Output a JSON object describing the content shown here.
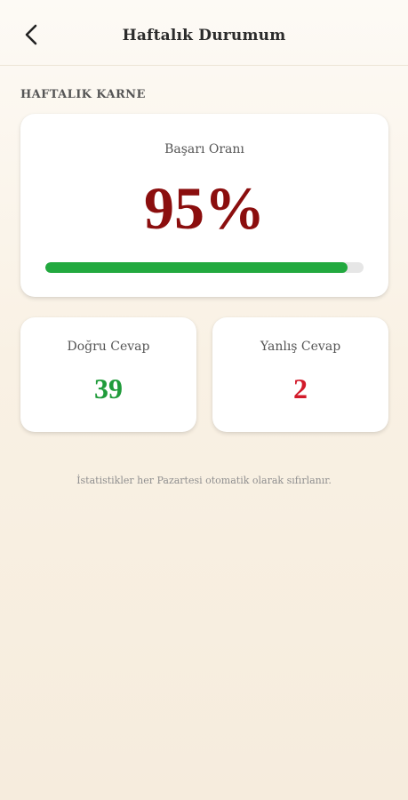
{
  "header": {
    "title": "Haftalık Durumum",
    "back_icon": "chevron-left-icon"
  },
  "section": {
    "label": "HAFTALIK KARNE"
  },
  "success": {
    "label": "Başarı Oranı",
    "value": "95%",
    "progress_percent": 95,
    "progress_color": "#22a93f",
    "value_color": "#8b0e0e"
  },
  "stats": {
    "correct": {
      "label": "Doğru Cevap",
      "value": "39",
      "color": "#1f9b3a"
    },
    "wrong": {
      "label": "Yanlış Cevap",
      "value": "2",
      "color": "#d21a2a"
    }
  },
  "footnote": "İstatistikler her Pazartesi otomatik olarak sıfırlanır."
}
